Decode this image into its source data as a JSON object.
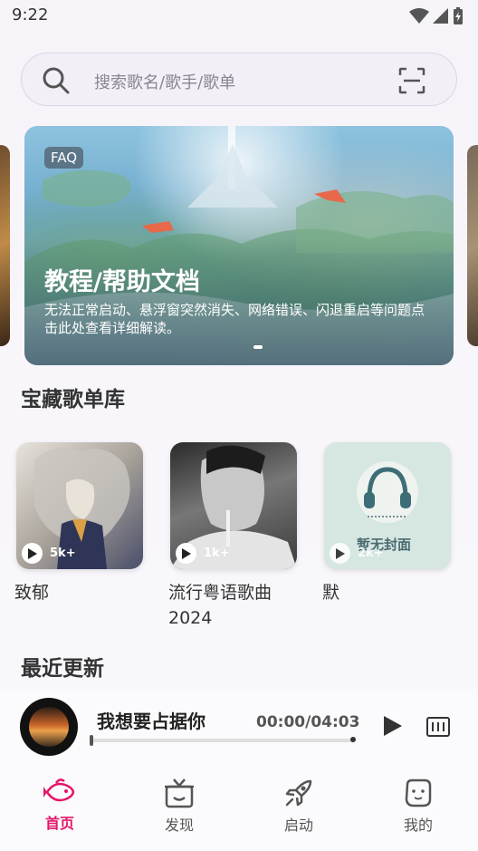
{
  "status_bar": {
    "time": "9:22"
  },
  "search": {
    "placeholder": "搜索歌名/歌手/歌单"
  },
  "banner": {
    "badge": "FAQ",
    "title": "教程/帮助文档",
    "description": "无法正常启动、悬浮窗突然消失、网络错误、闪退重启等问题点击此处查看详细解读。"
  },
  "sections": {
    "playlists_title": "宝藏歌单库",
    "recent_title": "最近更新"
  },
  "playlists": [
    {
      "name": "致郁",
      "play_count": "5k+"
    },
    {
      "name": "流行粤语歌曲2024",
      "play_count": "1k+"
    },
    {
      "name": "默",
      "play_count": "2k+",
      "cover_text": "暂无封面"
    }
  ],
  "player": {
    "title": "我想要占据你",
    "time": "00:00/04:03",
    "progress": 0
  },
  "nav": [
    {
      "label": "首页",
      "icon": "fish-icon",
      "active": true
    },
    {
      "label": "发现",
      "icon": "gift-box-icon",
      "active": false
    },
    {
      "label": "启动",
      "icon": "rocket-icon",
      "active": false
    },
    {
      "label": "我的",
      "icon": "face-icon",
      "active": false
    }
  ],
  "colors": {
    "accent": "#e4156a"
  }
}
